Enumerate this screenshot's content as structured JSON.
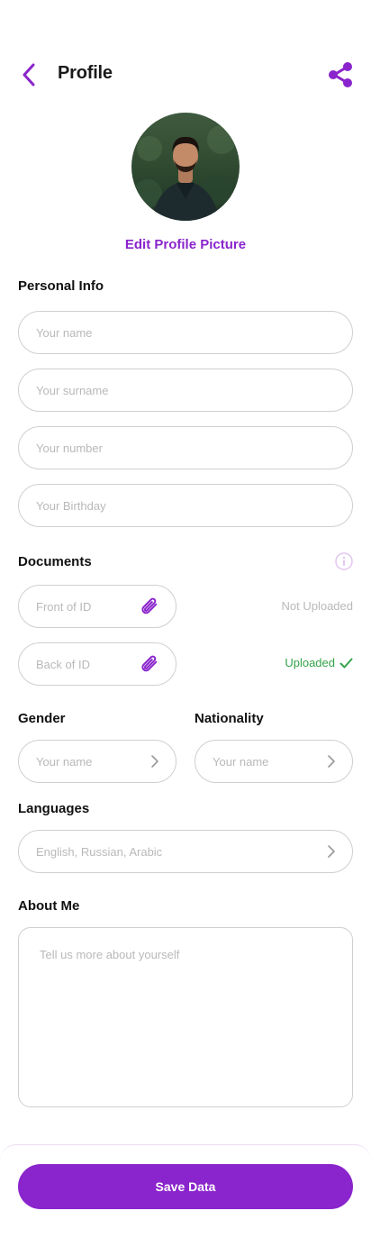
{
  "header": {
    "title": "Profile",
    "back_icon": "chevron-left-icon",
    "share_icon": "share-icon"
  },
  "avatar": {
    "edit_label": "Edit Profile Picture"
  },
  "personal_info": {
    "label": "Personal Info",
    "name_placeholder": "Your name",
    "surname_placeholder": "Your surname",
    "number_placeholder": "Your number",
    "birthday_placeholder": "Your Birthday"
  },
  "documents": {
    "label": "Documents",
    "info_icon": "info-icon",
    "front": {
      "placeholder": "Front of ID",
      "status": "Not Uploaded"
    },
    "back": {
      "placeholder": "Back of ID",
      "status": "Uploaded"
    }
  },
  "gender": {
    "label": "Gender",
    "value": "Your name"
  },
  "nationality": {
    "label": "Nationality",
    "value": "Your name"
  },
  "languages": {
    "label": "Languages",
    "value": "English, Russian, Arabic"
  },
  "about": {
    "label": "About Me",
    "placeholder": "Tell us more about yourself"
  },
  "footer": {
    "save_label": "Save Data"
  },
  "colors": {
    "accent": "#8a24cc",
    "success": "#34a34a",
    "border": "#cfcfcf",
    "placeholder": "#b9b9b9"
  }
}
